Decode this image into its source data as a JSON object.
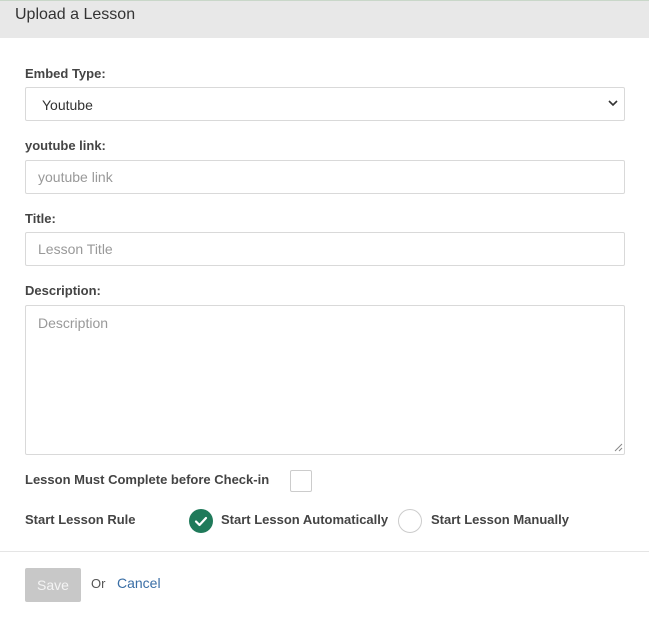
{
  "header": {
    "title": "Upload a Lesson"
  },
  "embed": {
    "label": "Embed Type:",
    "selected": "Youtube",
    "caret_icon": "chevron-down-icon"
  },
  "youtube": {
    "label": "youtube link:",
    "placeholder": "youtube link",
    "value": ""
  },
  "title": {
    "label": "Title:",
    "placeholder": "Lesson Title",
    "value": ""
  },
  "description": {
    "label": "Description:",
    "placeholder": "Description",
    "value": ""
  },
  "complete_rule": {
    "label": "Lesson Must Complete before Check-in",
    "checked": false
  },
  "start_rule": {
    "label": "Start Lesson Rule",
    "options": [
      {
        "label": "Start Lesson Automatically",
        "selected": true
      },
      {
        "label": "Start Lesson Manually",
        "selected": false
      }
    ],
    "accent": "#1f7a5a"
  },
  "footer": {
    "save_label": "Save",
    "or_text": "Or",
    "cancel_label": "Cancel"
  }
}
